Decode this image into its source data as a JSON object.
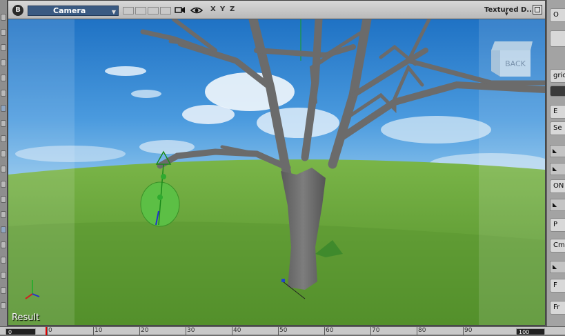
{
  "viewport": {
    "b_button": "B",
    "camera_label": "Camera",
    "axes": [
      "X",
      "Y",
      "Z"
    ],
    "display_mode": "Textured D...",
    "view_cube_label": "BACK",
    "result_label": "Result"
  },
  "timeline": {
    "start_frame": "0",
    "end_frame": "100",
    "ticks": [
      "0",
      "10",
      "20",
      "30",
      "40",
      "50",
      "60",
      "70",
      "80",
      "90"
    ]
  },
  "right_panel": {
    "items": [
      "O",
      "",
      "gric",
      "",
      "E",
      "Se",
      "",
      "",
      "ON",
      "",
      "P",
      "Cm",
      "",
      "F",
      "Fr"
    ]
  },
  "icons": {
    "b_button": "b-circle-icon",
    "camera_dropdown": "chevron-down-icon",
    "camera_view": "video-camera-icon",
    "visibility": "eye-icon",
    "maximize": "maximize-icon",
    "axis_gizmo": "xyz-axis-icon"
  },
  "colors": {
    "camera_select_bg": "#3a5a82",
    "sky": "#3e8fd6",
    "grass": "#5f9a2e",
    "trunk": "#6a6a6a",
    "leaf": "#5cbf45",
    "playhead": "#dd0000"
  }
}
